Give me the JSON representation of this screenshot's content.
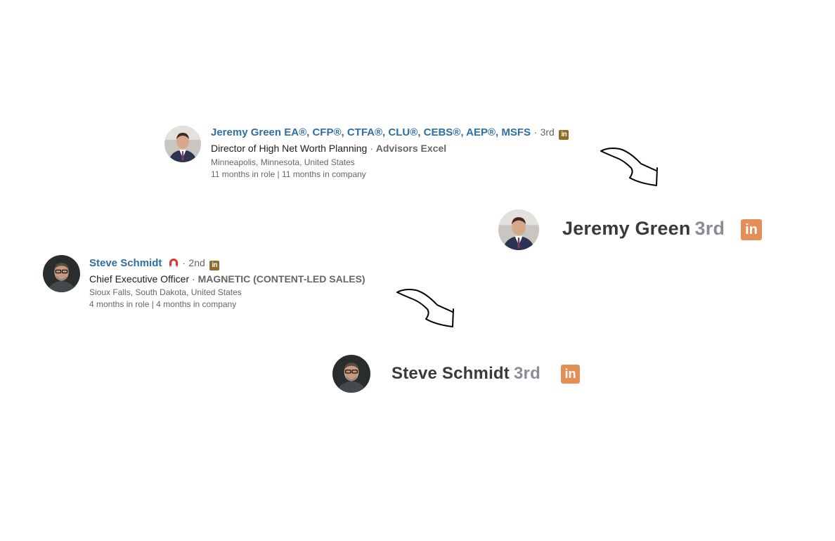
{
  "profiles": [
    {
      "name": "Jeremy Green EA®, CFP®, CTFA®, CLU®, CEBS®, AEP®, MSFS",
      "separator": "·",
      "degree": "3rd",
      "title": "Director of High Net Worth Planning",
      "title_separator": "·",
      "company": "Advisors Excel",
      "location": "Minneapolis, Minnesota, United States",
      "tenure": "11 months in role | 11 months in company"
    },
    {
      "name": "Steve Schmidt",
      "separator": "·",
      "degree": "2nd",
      "title": "Chief Executive Officer",
      "title_separator": "·",
      "company": "MAGNETIC (CONTENT-LED SALES)",
      "location": "Sioux Falls, South Dakota, United States",
      "tenure": "4 months in role | 4 months in company"
    }
  ],
  "previews": [
    {
      "name": "Jeremy Green",
      "degree": "3rd",
      "badge": "in"
    },
    {
      "name": "Steve Schmidt",
      "degree": "3rd",
      "badge": "in"
    }
  ],
  "icons": {
    "linkedin": "linkedin-icon",
    "magnet": "magnet-icon",
    "arrow": "curved-arrow-icon"
  },
  "colors": {
    "name_link": "#2f6fa8",
    "linkedin_small": "#8f6d24",
    "linkedin_big": "#e38f57",
    "magnet": "#d9332b"
  }
}
